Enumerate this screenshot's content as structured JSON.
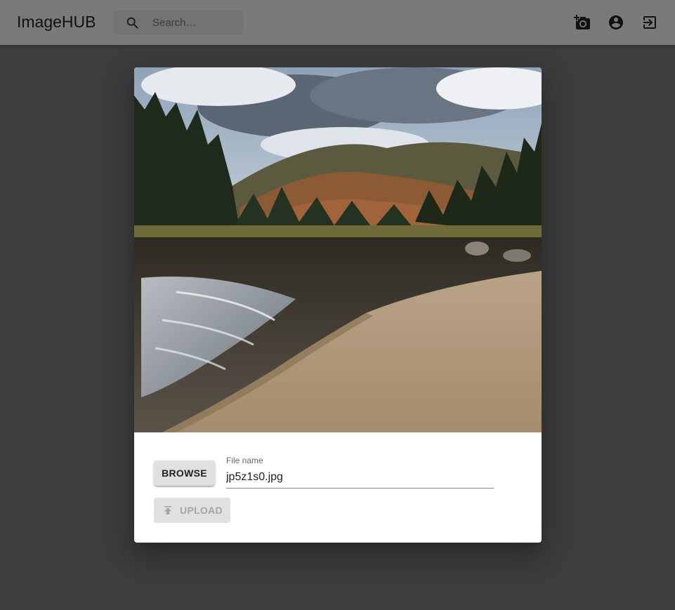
{
  "app": {
    "title": "ImageHUB"
  },
  "search": {
    "placeholder": "Search…",
    "value": "",
    "icon": "search-icon"
  },
  "toolbar": {
    "icons": [
      "add-photo-icon",
      "account-circle-icon",
      "logout-icon"
    ]
  },
  "dialog": {
    "preview_alt": "Preview of selected image: river with sandy beach and autumn forest",
    "browse_label": "Browse",
    "filename_label": "File name",
    "filename_value": "jp5z1s0.jpg",
    "upload_label": "Upload",
    "upload_icon": "upload-icon"
  },
  "colors": {
    "appbar": "#f5f5f5",
    "backdrop": "rgba(0,0,0,0.5)",
    "button": "#e0e0e0"
  }
}
